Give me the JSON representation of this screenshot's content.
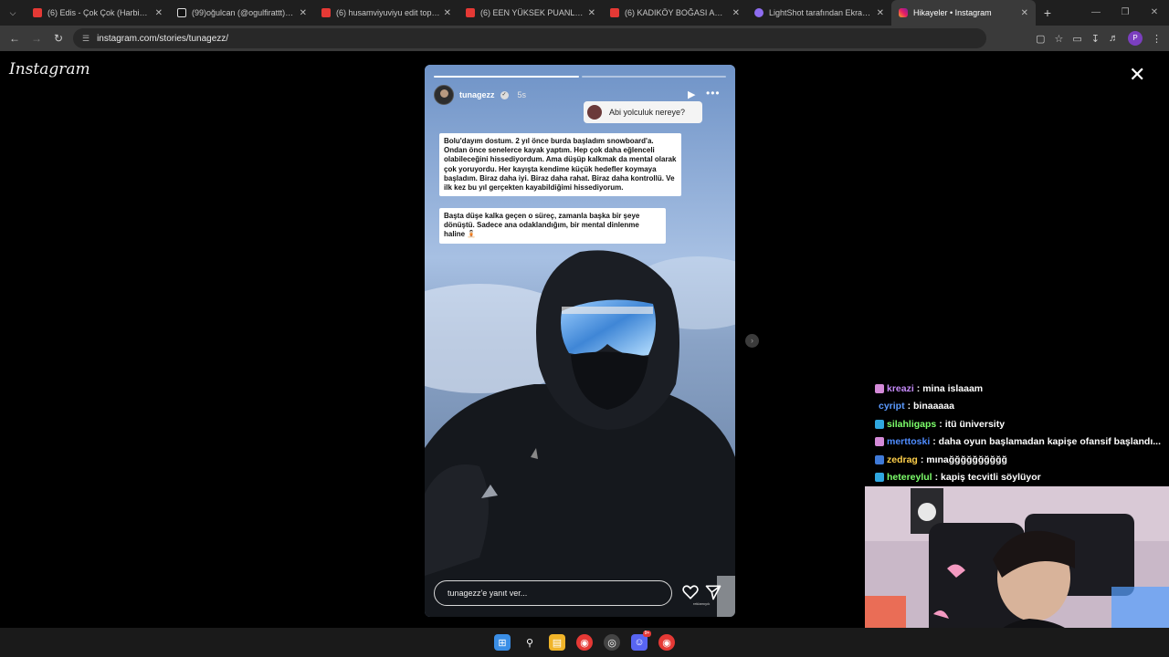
{
  "browser": {
    "tabs": [
      {
        "title": "(6) Edis - Çok Çok (Harbiye Kon",
        "favicon": "youtube-icon"
      },
      {
        "title": "(99)oğulcan (@ogulfirattt) | Tik",
        "favicon": "tiktok-icon"
      },
      {
        "title": "(6) husamviyuviyu edit toplantı",
        "favicon": "youtube-icon"
      },
      {
        "title": "(6) EEN YÜKSEK PUANLI RESTO",
        "favicon": "youtube-icon"
      },
      {
        "title": "(6) KADIKÖY BOĞASI ADANA YI",
        "favicon": "youtube-icon"
      },
      {
        "title": "LightShot tarafından Ekran Gör",
        "favicon": "lightshot-icon"
      },
      {
        "title": "Hikayeler • Instagram",
        "favicon": "instagram-icon",
        "active": true
      }
    ],
    "new_tab": "+",
    "url": "instagram.com/stories/tunagezz/",
    "profile_initial": "P"
  },
  "instagram": {
    "logo": "Instagram",
    "story": {
      "username": "tunagezz",
      "time_ago": "5s",
      "progress": [
        1.0,
        0.0
      ],
      "question": "Abi yolculuk nereye?",
      "text1": "Bolu'dayım dostum. 2 yıl önce burda başladım snowboard'a. Ondan önce senelerce kayak yaptım. Hep çok daha eğlenceli olabileceğini hissediyordum. Ama düşüp kalkmak da mental olarak çok yoruyordu. Her kayışta kendime küçük hedefler koymaya başladım. Biraz daha iyi. Biraz daha rahat. Biraz daha kontrollü. Ve ilk kez bu yıl gerçekten kayabildiğimi hissediyorum.",
      "text2": "Başta düşe kalka geçen o süreç, zamanla başka bir şeye dönüştü. Sadece ana odaklandığım, bir mental dinlenme haline 🧘🏻",
      "reply_placeholder": "tunagezz'e yanıt ver...",
      "send_caption": "reklamıyık"
    }
  },
  "chat": [
    {
      "user": "kreazi",
      "color": "#c58af9",
      "badge": "#d48ad8",
      "text": ": mina islaaam"
    },
    {
      "user": "cyript",
      "color": "#5b9bff",
      "badge": null,
      "text": ": binaaaaa"
    },
    {
      "user": "silahligaps",
      "color": "#7dff6b",
      "badge": "#2fa7e0",
      "text": ": itü üniversity"
    },
    {
      "user": "merttoski",
      "color": "#4f8cff",
      "badge": "#d48ad8",
      "text": ": daha oyun başlamadan kapişe ofansif başlandı..."
    },
    {
      "user": "zedrag",
      "color": "#ffd04a",
      "badge": "#3f7ad8",
      "text": ": mınağğğğğğğğğğ"
    },
    {
      "user": "hetereylul",
      "color": "#7dff6b",
      "badge": "#2fa7e0",
      "text": ": kapiş tecvitli söylüyor"
    }
  ],
  "taskbar": [
    {
      "name": "windows-start-icon",
      "color": "#3a8ee6"
    },
    {
      "name": "search-icon",
      "color": "transparent"
    },
    {
      "name": "file-explorer-icon",
      "color": "#f0b429"
    },
    {
      "name": "chrome-icon",
      "color": "#e53935"
    },
    {
      "name": "obs-icon",
      "color": "#444"
    },
    {
      "name": "discord-icon",
      "color": "#5865f2",
      "badge": "9+"
    },
    {
      "name": "chrome-icon",
      "color": "#e53935"
    }
  ]
}
